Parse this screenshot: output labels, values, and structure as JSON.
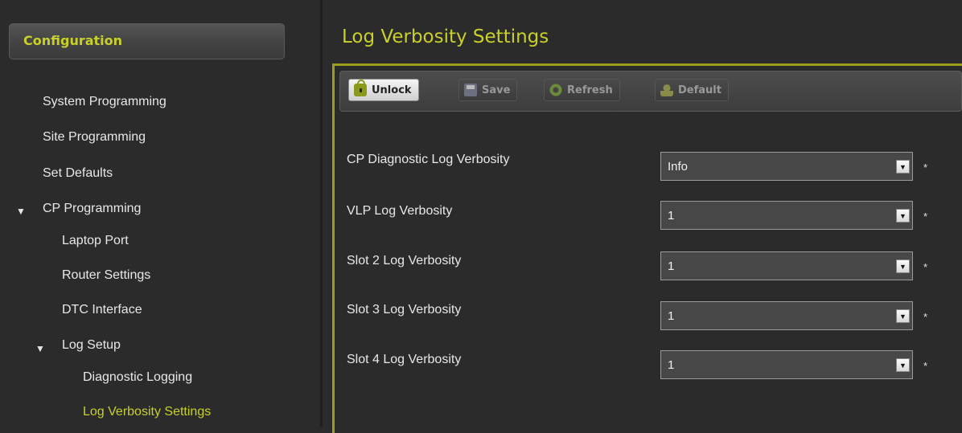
{
  "sidebar": {
    "header": "Configuration",
    "items": [
      {
        "label": "System Programming"
      },
      {
        "label": "Site Programming"
      },
      {
        "label": "Set Defaults"
      },
      {
        "label": "CP Programming"
      },
      {
        "label": "Laptop Port"
      },
      {
        "label": "Router Settings"
      },
      {
        "label": "DTC Interface"
      },
      {
        "label": "Log Setup"
      },
      {
        "label": "Diagnostic Logging"
      },
      {
        "label": "Log Verbosity Settings"
      }
    ]
  },
  "main": {
    "title": "Log Verbosity Settings",
    "toolbar": {
      "unlock": "Unlock",
      "save": "Save",
      "refresh": "Refresh",
      "default": "Default"
    },
    "fields": [
      {
        "label": "CP Diagnostic Log Verbosity",
        "value": "Info",
        "required_mark": "*"
      },
      {
        "label": "VLP Log Verbosity",
        "value": "1",
        "required_mark": "*"
      },
      {
        "label": "Slot 2 Log Verbosity",
        "value": "1",
        "required_mark": "*"
      },
      {
        "label": "Slot 3 Log Verbosity",
        "value": "1",
        "required_mark": "*"
      },
      {
        "label": "Slot 4 Log Verbosity",
        "value": "1",
        "required_mark": "*"
      }
    ]
  },
  "colors": {
    "accent": "#c9d02a",
    "panel_border": "#9aa01e",
    "background": "#2b2b2b"
  },
  "icons": {
    "unlock": "lock-open-icon",
    "save": "floppy-disk-icon",
    "refresh": "refresh-icon",
    "default": "default-icon",
    "expanded": "triangle-down-icon",
    "dropdown": "chevron-down-icon"
  }
}
